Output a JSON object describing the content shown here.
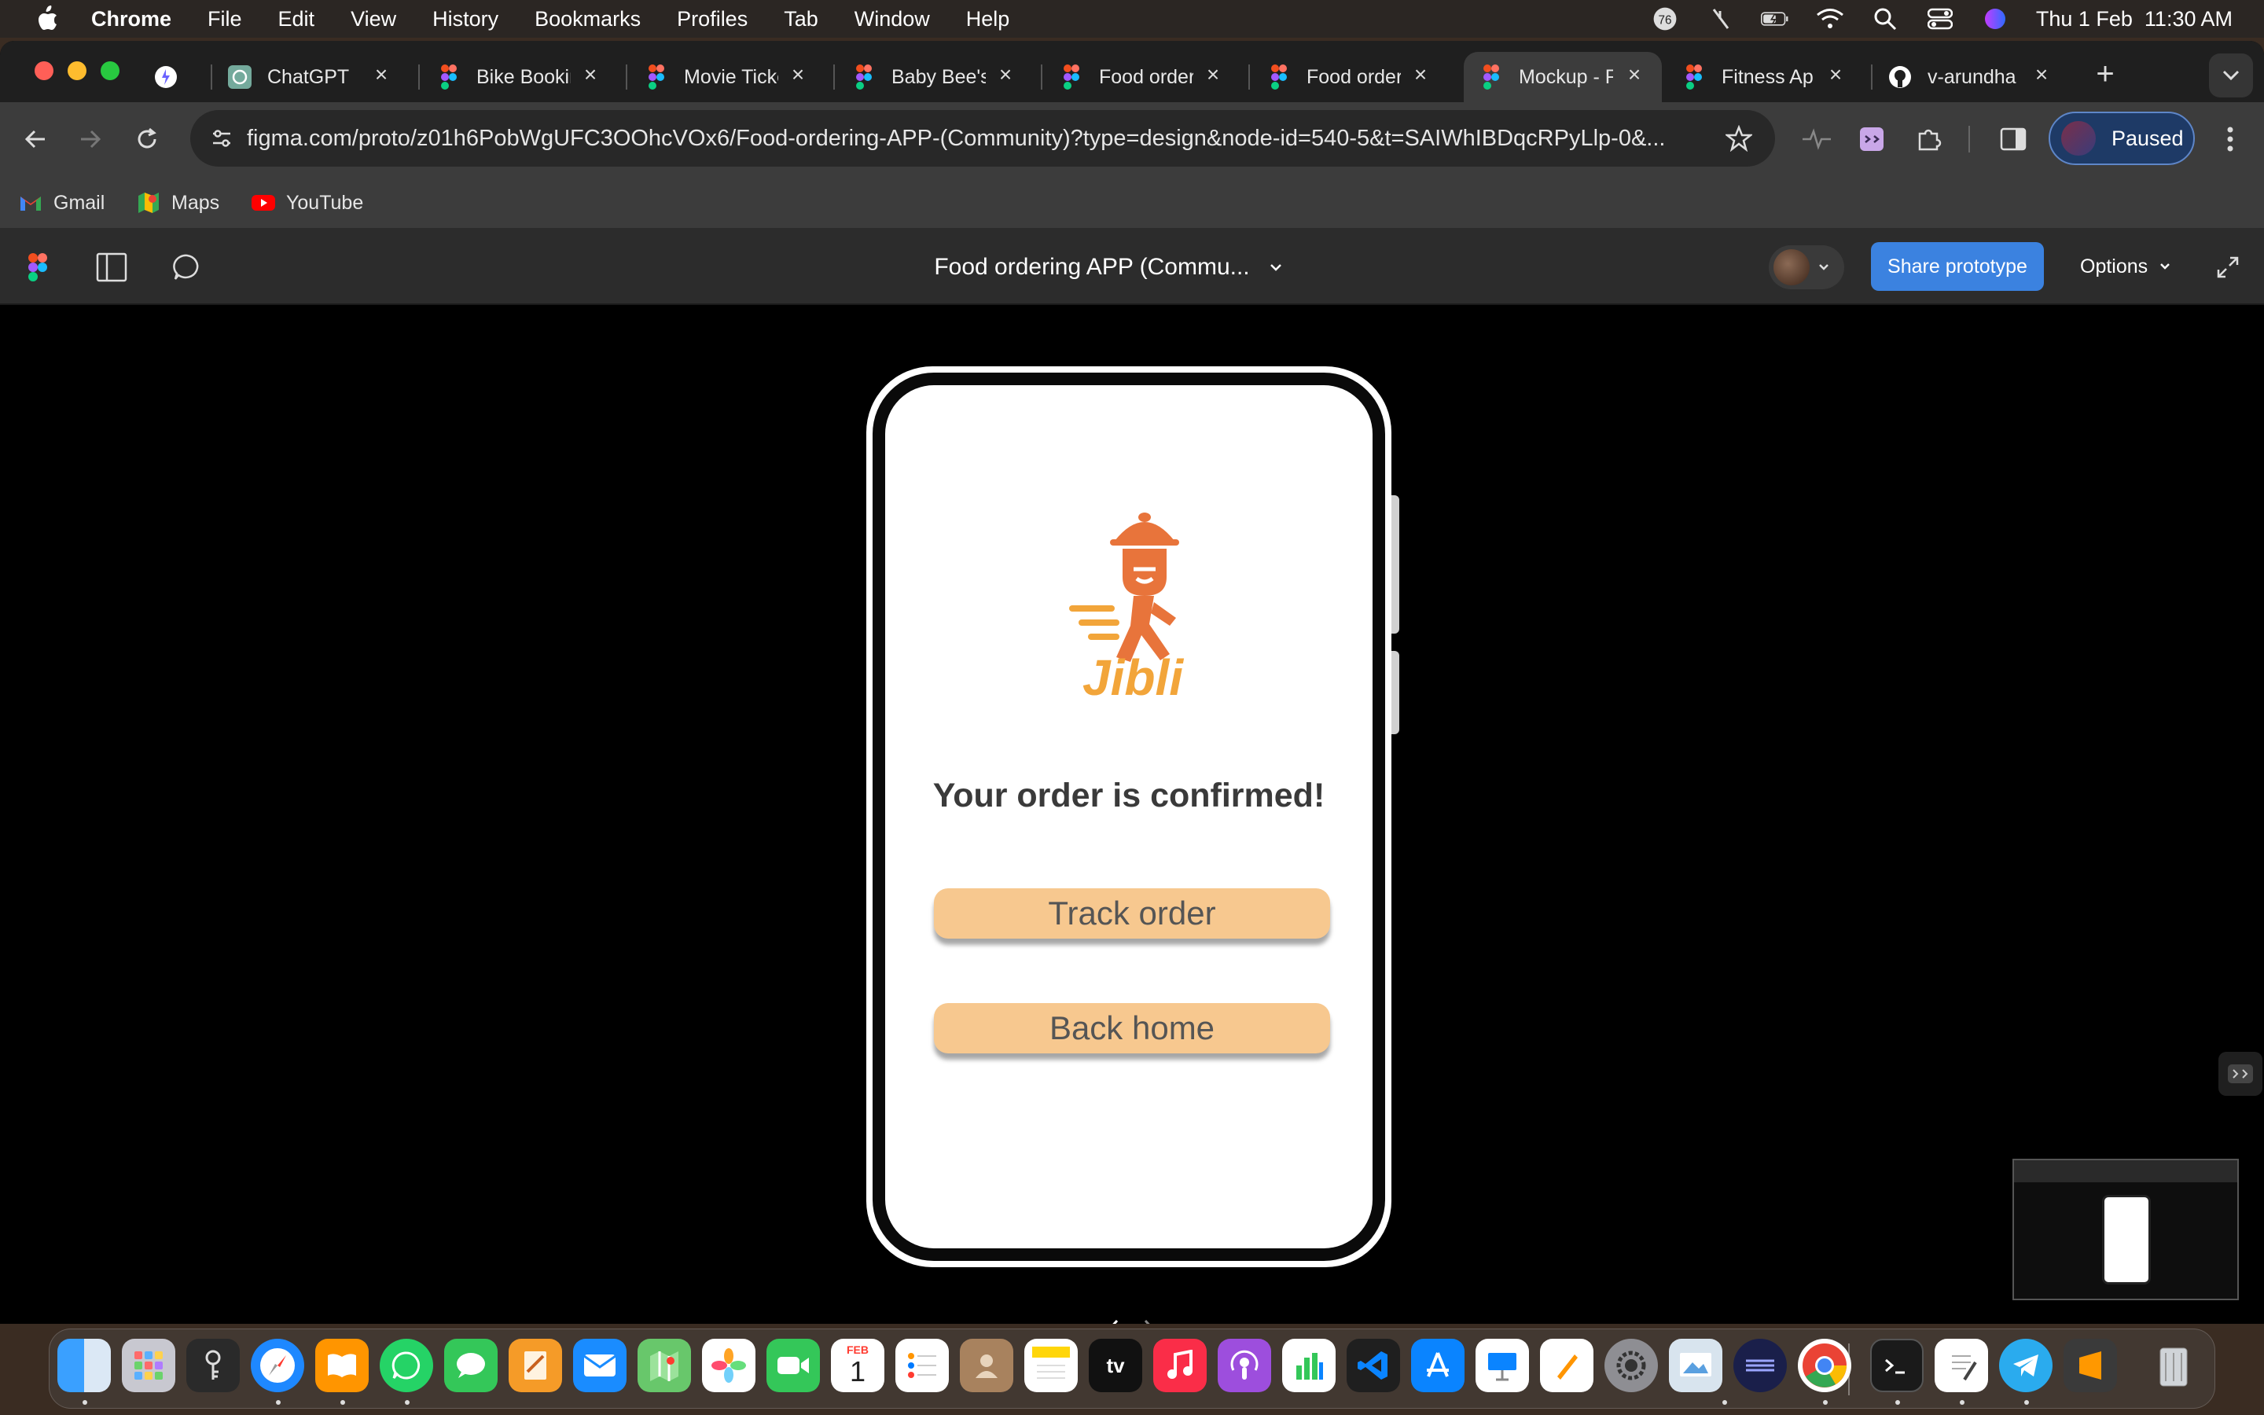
{
  "menubar": {
    "app": "Chrome",
    "items": [
      "File",
      "Edit",
      "View",
      "History",
      "Bookmarks",
      "Profiles",
      "Tab",
      "Window",
      "Help"
    ],
    "notification_count": "76",
    "datetime": "Thu 1 Feb  11:30 AM"
  },
  "tabs": [
    {
      "label": "",
      "icon": "perplexity-icon"
    },
    {
      "label": "ChatGPT",
      "icon": "chatgpt-icon"
    },
    {
      "label": "Bike Booking",
      "icon": "figma-icon"
    },
    {
      "label": "Movie Ticket",
      "icon": "figma-icon"
    },
    {
      "label": "Baby Bee's",
      "icon": "figma-icon"
    },
    {
      "label": "Food order",
      "icon": "figma-icon"
    },
    {
      "label": "Food order",
      "icon": "figma-icon"
    },
    {
      "label": "Mockup - F",
      "icon": "figma-icon",
      "active": true
    },
    {
      "label": "Fitness Ap",
      "icon": "figma-icon"
    },
    {
      "label": "v-arundha",
      "icon": "github-icon"
    }
  ],
  "address": {
    "url": "figma.com/proto/z01h6PobWgUFC3OOhcVOx6/Food-ordering-APP-(Community)?type=design&node-id=540-5&t=SAIWhIBDqcRPyLlp-0&..."
  },
  "profile": {
    "label": "Paused"
  },
  "bookmarks": [
    {
      "label": "Gmail",
      "icon": "gmail-icon"
    },
    {
      "label": "Maps",
      "icon": "maps-icon"
    },
    {
      "label": "YouTube",
      "icon": "youtube-icon"
    }
  ],
  "figma": {
    "file_title": "Food ordering APP (Commu...",
    "share_label": "Share prototype",
    "options_label": "Options"
  },
  "app_screen": {
    "brand": "Jibli",
    "headline": "Your order is confirmed!",
    "track_button": "Track order",
    "home_button": "Back home"
  },
  "colors": {
    "accent_orange": "#e8743b",
    "button_fill": "#f7c88f",
    "share_blue": "#3b82e0"
  },
  "dock": {
    "calendar_month": "FEB",
    "calendar_day": "1",
    "tv_label": "tv",
    "apps": [
      "finder-icon",
      "launchpad-icon",
      "keychain-icon",
      "safari-icon",
      "books-icon",
      "whatsapp-icon",
      "messages-icon",
      "pages-icon",
      "mail-icon",
      "maps-icon",
      "photos-icon",
      "facetime-icon",
      "calendar-icon",
      "reminders-icon",
      "contacts-icon",
      "notes-icon",
      "appletv-icon",
      "music-icon",
      "podcasts-icon",
      "numbers-icon",
      "vscode-icon",
      "appstore-icon",
      "keynote-icon",
      "pages-pen-icon",
      "system-settings-icon",
      "preview-icon",
      "proxyman-icon",
      "chrome-icon",
      "terminal-icon",
      "textedit-icon",
      "telegram-icon",
      "sublime-icon",
      "trash-icon"
    ]
  }
}
